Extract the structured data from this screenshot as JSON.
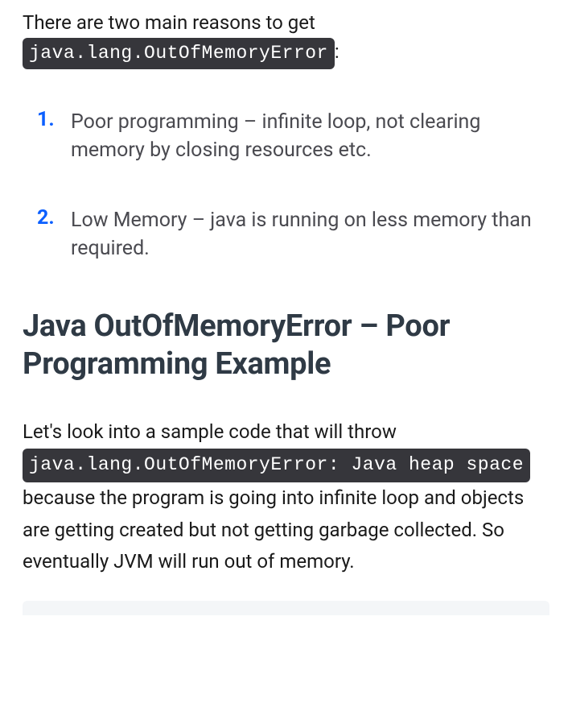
{
  "intro": {
    "prefix": "There are two main reasons to get ",
    "code": "java.lang.OutOfMemoryError",
    "suffix": ":"
  },
  "reasons": [
    "Poor programming – infinite loop, not clearing memory by closing resources etc.",
    "Low Memory – java is running on less memory than required."
  ],
  "heading": "Java OutOfMemoryError – Poor Programming Example",
  "body": {
    "prefix": "Let's look into a sample code that will throw ",
    "code": "java.lang.OutOfMemoryError: Java heap space",
    "suffix": " because the program is going into infinite loop and objects are getting created but not getting garbage collected. So eventually JVM will run out of memory."
  }
}
